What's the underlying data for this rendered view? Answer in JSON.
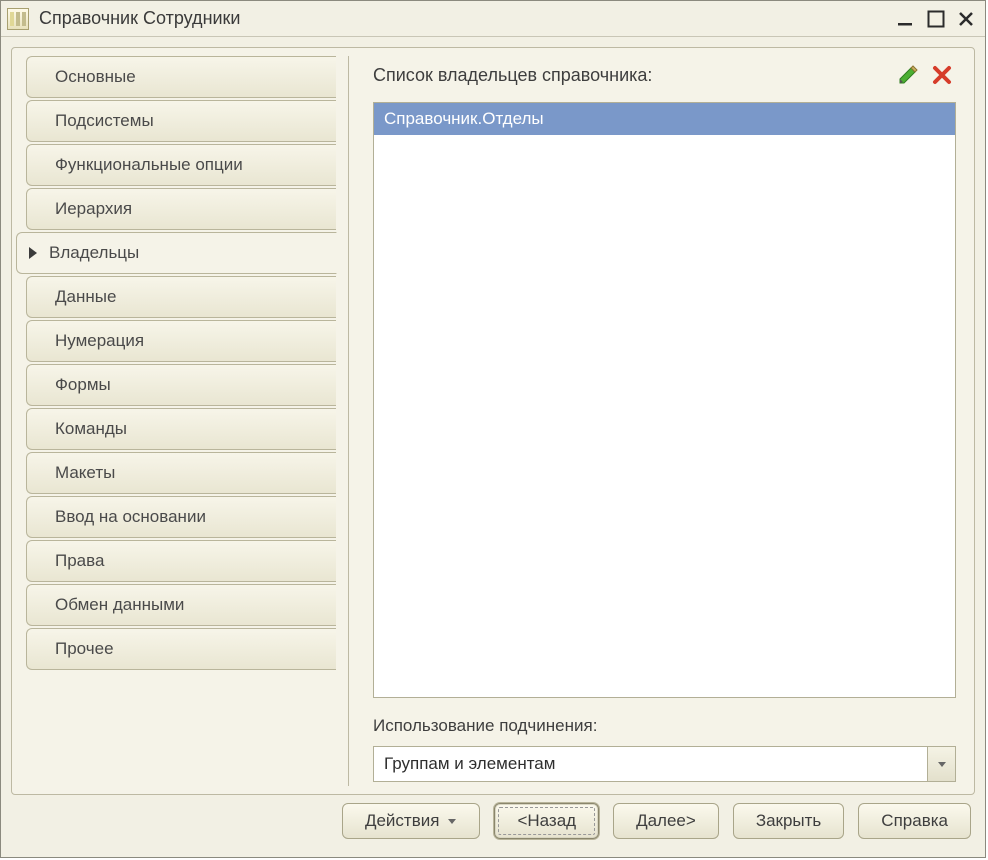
{
  "window": {
    "title": "Справочник Сотрудники"
  },
  "tabs": [
    {
      "id": "main",
      "label": "Основные",
      "active": false
    },
    {
      "id": "subsystems",
      "label": "Подсистемы",
      "active": false
    },
    {
      "id": "funcopts",
      "label": "Функциональные опции",
      "active": false
    },
    {
      "id": "hierarchy",
      "label": "Иерархия",
      "active": false
    },
    {
      "id": "owners",
      "label": "Владельцы",
      "active": true
    },
    {
      "id": "data",
      "label": "Данные",
      "active": false
    },
    {
      "id": "numbering",
      "label": "Нумерация",
      "active": false
    },
    {
      "id": "forms",
      "label": "Формы",
      "active": false
    },
    {
      "id": "commands",
      "label": "Команды",
      "active": false
    },
    {
      "id": "layouts",
      "label": "Макеты",
      "active": false
    },
    {
      "id": "inputbasis",
      "label": "Ввод на основании",
      "active": false
    },
    {
      "id": "rights",
      "label": "Права",
      "active": false
    },
    {
      "id": "exchange",
      "label": "Обмен данными",
      "active": false
    },
    {
      "id": "other",
      "label": "Прочее",
      "active": false
    }
  ],
  "owners_panel": {
    "heading": "Список владельцев справочника:",
    "items": [
      {
        "label": "Справочник.Отделы",
        "selected": true
      }
    ],
    "subordination_label": "Использование подчинения:",
    "subordination_value": "Группам и элементам"
  },
  "footer": {
    "actions": "Действия",
    "back": "<Назад",
    "next": "Далее>",
    "close": "Закрыть",
    "help": "Справка"
  }
}
